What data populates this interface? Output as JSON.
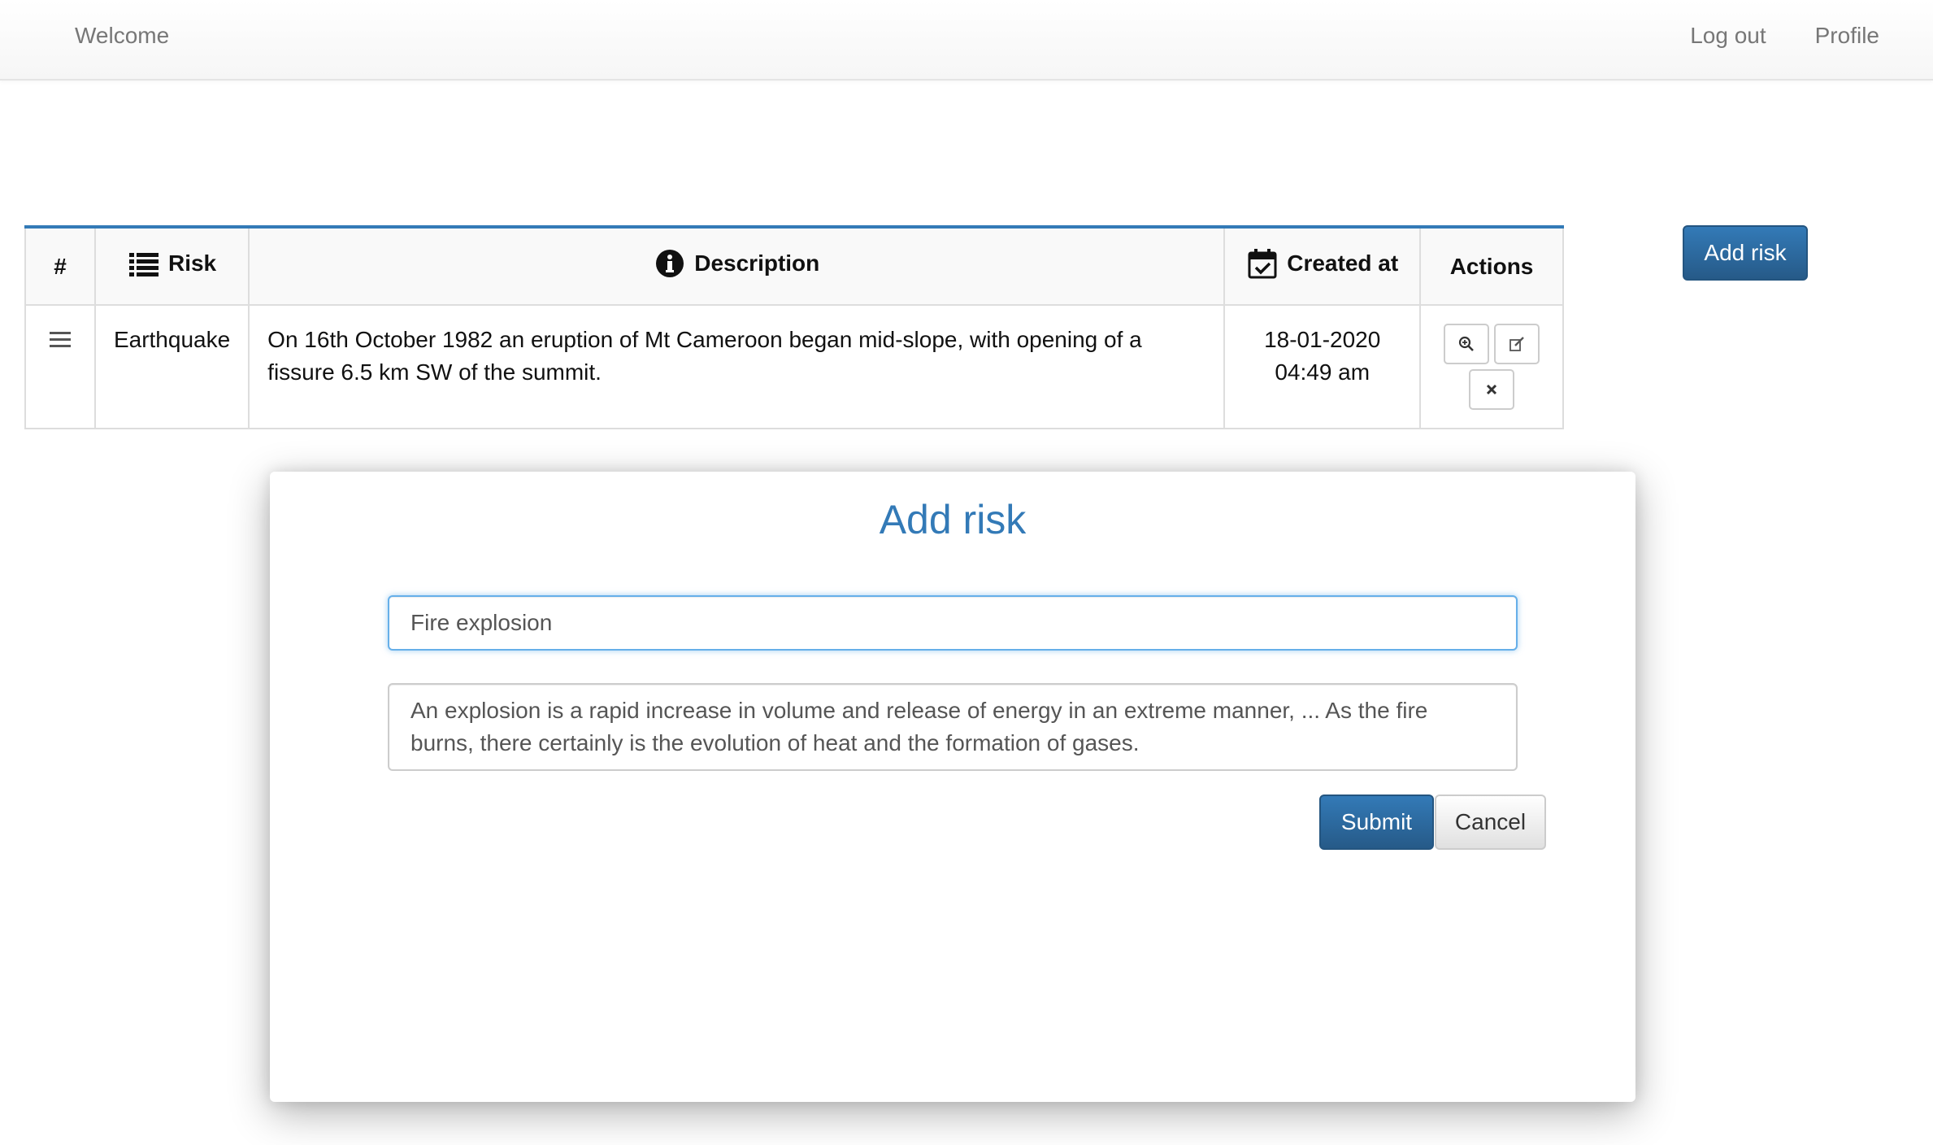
{
  "navbar": {
    "brand": "Welcome",
    "links": [
      {
        "label": "Log out"
      },
      {
        "label": "Profile"
      }
    ]
  },
  "table": {
    "headers": {
      "index": "#",
      "risk": "Risk",
      "description": "Description",
      "created_at": "Created at",
      "actions": "Actions"
    },
    "rows": [
      {
        "risk": "Earthquake",
        "description": "On 16th October 1982 an eruption of Mt Cameroon began mid-slope, with opening of a fissure 6.5 km SW of the summit.",
        "created_date": "18-01-2020",
        "created_time": "04:49 am"
      }
    ]
  },
  "toolbar": {
    "add_risk_label": "Add risk"
  },
  "modal": {
    "title": "Add risk",
    "title_value": "Fire explosion",
    "description_value": "An explosion is a rapid increase in volume and release of energy in an extreme manner, ... As the fire burns, there certainly is the evolution of heat and the formation of gases.",
    "submit_label": "Submit",
    "cancel_label": "Cancel"
  },
  "colors": {
    "accent": "#337ab7",
    "primary_button": "#286090",
    "focus_border": "#66afe9"
  },
  "icons": {
    "list": "list-icon",
    "info": "info-icon",
    "calendar": "calendar-check-icon",
    "menu": "hamburger-icon",
    "view": "zoom-in-icon",
    "edit": "edit-icon",
    "delete": "close-icon"
  }
}
